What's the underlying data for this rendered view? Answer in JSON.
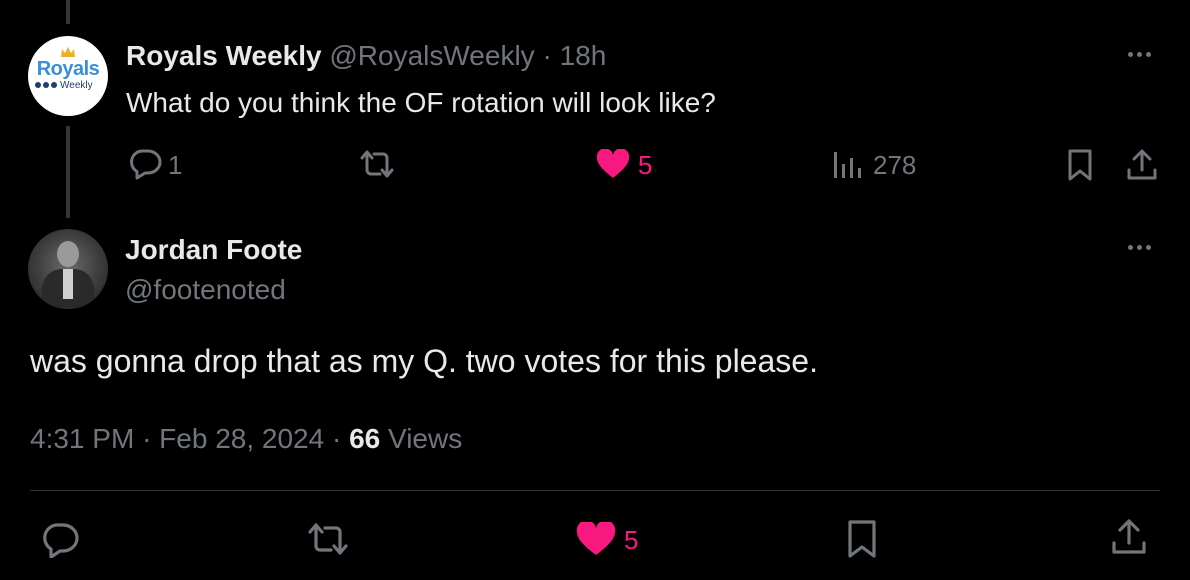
{
  "colors": {
    "accent_like": "#f91880",
    "muted": "#71767b",
    "text": "#e7e9ea",
    "background": "#000000"
  },
  "parent_tweet": {
    "avatar_text": "Royals",
    "avatar_subtext": "Weekly",
    "display_name": "Royals Weekly",
    "handle": "@RoyalsWeekly",
    "separator": "·",
    "time": "18h",
    "text": "What do you think the OF rotation will look like?",
    "replies": "1",
    "likes": "5",
    "views": "278",
    "icons": [
      "more-icon",
      "reply-icon",
      "retweet-icon",
      "like-icon",
      "views-icon",
      "bookmark-icon",
      "share-icon"
    ]
  },
  "main_tweet": {
    "display_name": "Jordan Foote",
    "handle": "@footenoted",
    "text": "was gonna drop that as my Q. two votes for this please.",
    "time": "4:31 PM",
    "sep1": "·",
    "date": "Feb 28, 2024",
    "sep2": "·",
    "views_count": "66",
    "views_label": "Views",
    "likes": "5",
    "icons": [
      "more-icon",
      "reply-icon",
      "retweet-icon",
      "like-icon",
      "bookmark-icon",
      "share-icon"
    ]
  }
}
